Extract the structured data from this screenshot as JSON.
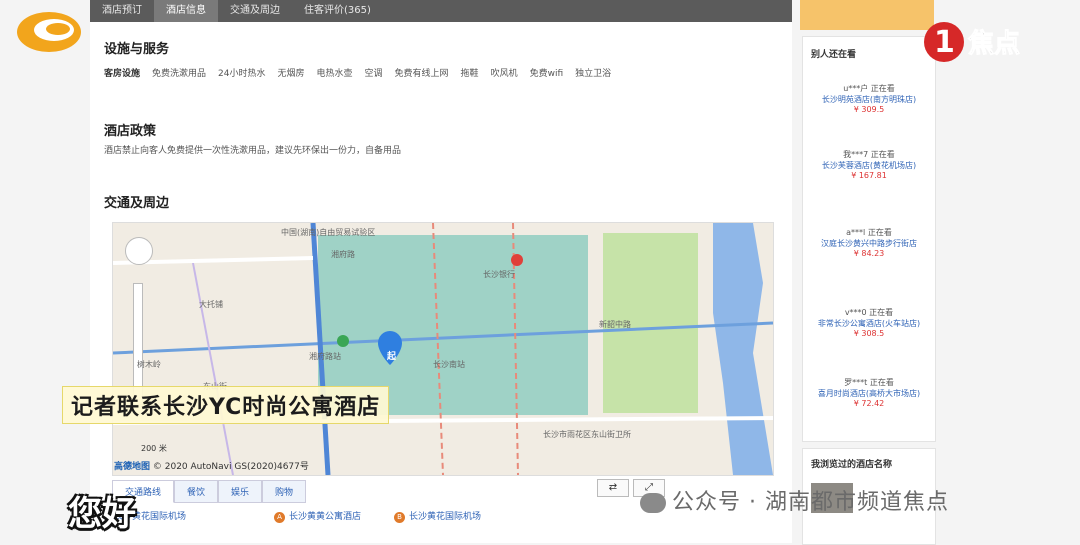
{
  "tabs": [
    "酒店预订",
    "酒店信息",
    "交通及周边",
    "住客评价(365)"
  ],
  "active_tab": 1,
  "facilities": {
    "heading": "设施与服务",
    "label": "客房设施",
    "items": [
      "免费洗漱用品",
      "24小时热水",
      "无烟房",
      "电热水壶",
      "空调",
      "免费有线上网",
      "拖鞋",
      "吹风机",
      "免费wifi",
      "独立卫浴"
    ]
  },
  "policy": {
    "heading": "酒店政策",
    "text": "酒店禁止向客人免费提供一次性洗漱用品，建议先环保出一份力，自备用品"
  },
  "transport": {
    "heading": "交通及周边"
  },
  "map": {
    "pois": [
      "中国(湖南)自由贸易试验区",
      "湘府路",
      "湘府路站",
      "长沙银行",
      "长沙市雨花区东山街卫所",
      "大托铺",
      "新韶中路",
      "长沙南站",
      "树木岭",
      "东山街"
    ],
    "scale": "200 米",
    "logo": "高德地图",
    "copyright": "© 2020 AutoNavi  GS(2020)4677号",
    "marker": "起"
  },
  "caption": "记者联系长沙YC时尚公寓酒店",
  "bottom_tabs": [
    "交通路线",
    "餐饮",
    "娱乐",
    "购物"
  ],
  "route_from": "长沙黄花国际机场",
  "route_a": "长沙黄黄公寓酒店",
  "route_b": "长沙黄花国际机场",
  "subtitle": "您好",
  "watermark": "公众号 · 湖南都市频道焦点",
  "channel": {
    "logo_text": "焦点"
  },
  "sidebar": {
    "title": "别人还在看",
    "items": [
      {
        "user": "u***户 正在看",
        "hotel": "长沙明苑酒店(南方明珠店)",
        "price": "¥ 309.5"
      },
      {
        "user": "我***7 正在看",
        "hotel": "长沙芙蓉酒店(黄花机场店)",
        "price": "¥ 167.81"
      },
      {
        "user": "a***l 正在看",
        "hotel": "汉庭长沙黄兴中路步行街店",
        "price": "¥ 84.23"
      },
      {
        "user": "v***0 正在看",
        "hotel": "非常长沙公寓酒店(火车站店)",
        "price": "¥ 308.5"
      },
      {
        "user": "罗***t 正在看",
        "hotel": "喜月时尚酒店(高桥大市场店)",
        "price": "¥ 72.42"
      }
    ],
    "recent_title": "我浏览过的酒店名称"
  }
}
